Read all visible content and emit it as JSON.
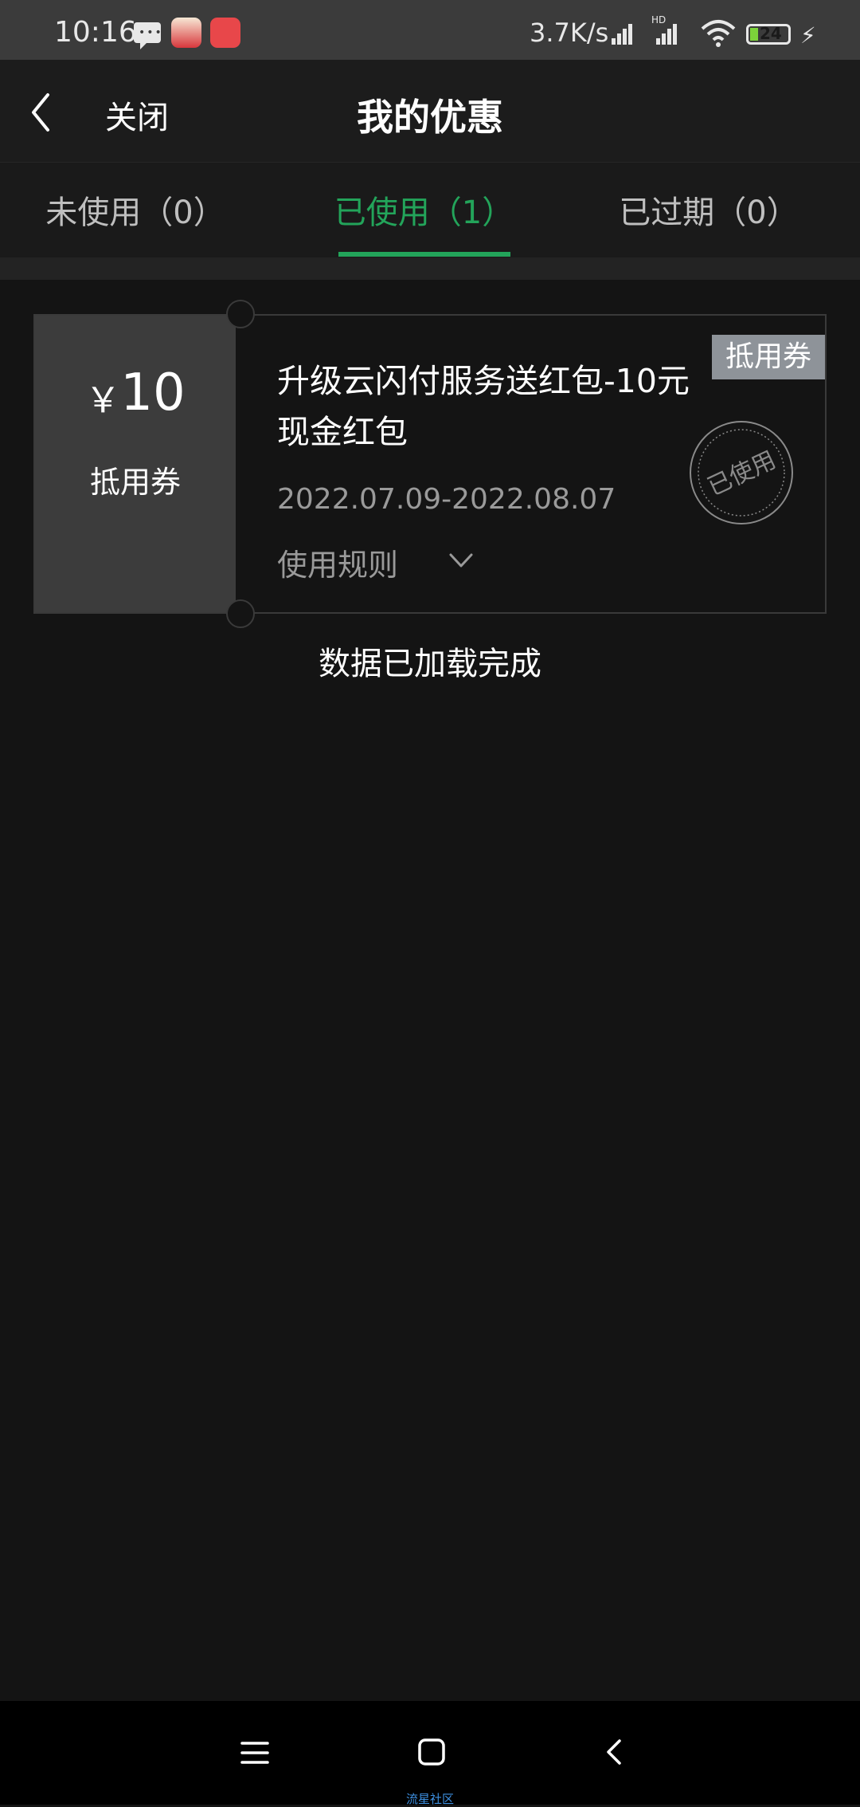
{
  "status_bar": {
    "time": "10:16",
    "net_speed": "3.7K/s",
    "hd": "HD",
    "battery": "24",
    "icons": [
      "message-icon",
      "app-icon",
      "app-icon",
      "signal-icon",
      "signal-icon",
      "wifi-icon",
      "battery-icon",
      "charging-icon"
    ]
  },
  "header": {
    "back_icon": "chevron-left-icon",
    "close_label": "关闭",
    "title": "我的优惠"
  },
  "tabs": [
    {
      "label": "未使用（0）",
      "active": false
    },
    {
      "label": "已使用（1）",
      "active": true
    },
    {
      "label": "已过期（0）",
      "active": false
    }
  ],
  "accent_color": "#23a45a",
  "coupons": [
    {
      "currency": "￥",
      "amount": "10",
      "type_label": "抵用券",
      "badge": "抵用券",
      "title": "升级云闪付服务送红包-10元现金红包",
      "validity": "2022.07.09-2022.08.07",
      "rules_label": "使用规则",
      "stamp_text": "已使用"
    }
  ],
  "footer_status": "数据已加载完成",
  "nav_bar": {
    "icons": [
      "menu-icon",
      "home-icon",
      "back-icon"
    ],
    "watermark": "流星社区"
  }
}
